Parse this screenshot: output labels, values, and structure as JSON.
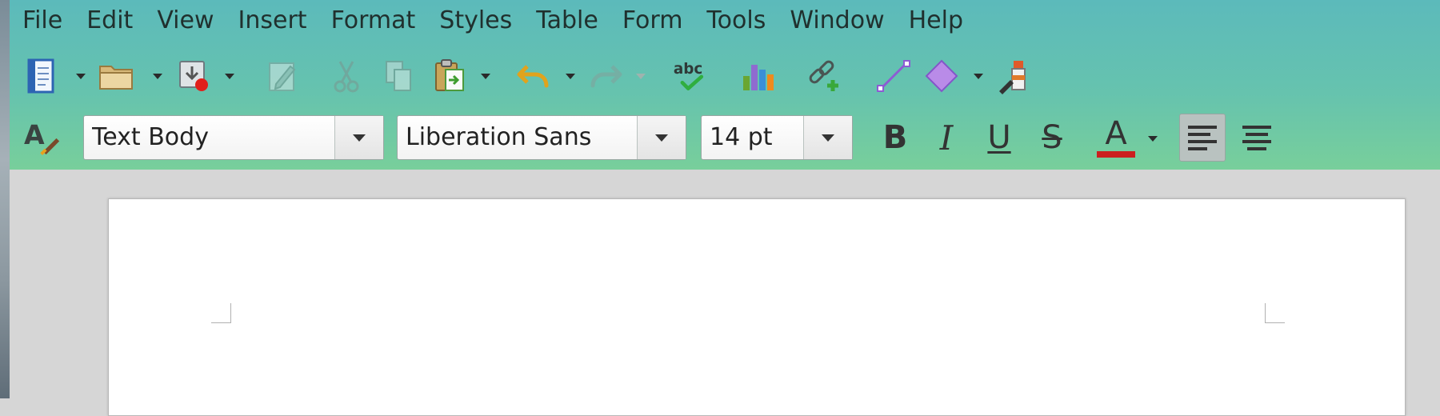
{
  "menubar": {
    "items": [
      "File",
      "Edit",
      "View",
      "Insert",
      "Format",
      "Styles",
      "Table",
      "Form",
      "Tools",
      "Window",
      "Help"
    ]
  },
  "standard_toolbar": {
    "icons": [
      "new-document-icon",
      "open-folder-icon",
      "save-icon",
      "edit-pencil-icon",
      "cut-scissors-icon",
      "copy-icon",
      "paste-icon",
      "undo-icon",
      "redo-icon",
      "spellcheck-icon",
      "bar-chart-icon",
      "hyperlink-icon",
      "line-icon",
      "diamond-shape-icon",
      "clone-formatting-icon"
    ],
    "spellcheck_text": "abc"
  },
  "formatting_toolbar": {
    "paragraph_style": "Text Body",
    "font_name": "Liberation Sans",
    "font_size": "14 pt",
    "bold_label": "B",
    "italic_label": "I",
    "underline_label": "U",
    "strikethrough_label": "S",
    "font_color_label": "A",
    "font_color": "#cc1f1f"
  },
  "colors": {
    "toolbar_gradient_top": "#5cbabb",
    "toolbar_gradient_bottom": "#78cf9b",
    "workspace": "#d6d6d6",
    "page": "#ffffff"
  }
}
